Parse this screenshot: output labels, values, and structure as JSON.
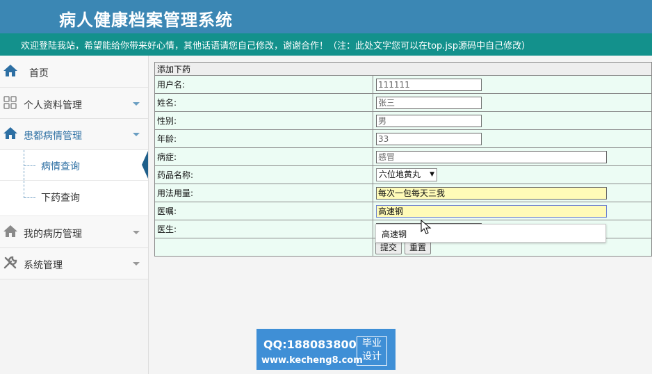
{
  "app": {
    "title": "病人健康档案管理系统",
    "notice": "欢迎登陆我站，希望能给你带来好心情，其他话语请您自己修改，谢谢合作！（注：此处文字您可以在top.jsp源码中自己修改）"
  },
  "sidebar": {
    "items": [
      {
        "label": "首页",
        "icon": "home-icon"
      },
      {
        "label": "个人资料管理",
        "icon": "grid-icon"
      },
      {
        "label": "患都病情管理",
        "icon": "home-icon"
      },
      {
        "label": "我的病历管理",
        "icon": "home-icon"
      },
      {
        "label": "系统管理",
        "icon": "wrench-icon"
      }
    ],
    "subitems": [
      {
        "label": "病情查询"
      },
      {
        "label": "下药查询"
      }
    ]
  },
  "form": {
    "caption": "添加下药",
    "fields": [
      {
        "label": "用户名:",
        "value": "111111"
      },
      {
        "label": "姓名:",
        "value": "张三"
      },
      {
        "label": "性别:",
        "value": "男"
      },
      {
        "label": "年龄:",
        "value": "33"
      },
      {
        "label": "病症:",
        "value": "感冒"
      },
      {
        "label": "药品名称:",
        "value": "六位地黄丸"
      },
      {
        "label": "用法用量:",
        "value": "每次一包每天三我"
      },
      {
        "label": "医嘱:",
        "value": "高速钢"
      },
      {
        "label": "医生:",
        "value": ""
      }
    ],
    "submit_label": "提交",
    "reset_label": "重置",
    "autocomplete": "高速钢"
  },
  "watermark": {
    "qq": "QQ:188083800",
    "url": "www.kecheng8.com",
    "tag_line1": "毕业",
    "tag_line2": "设计"
  },
  "colors": {
    "header": "#3b87b4",
    "notice_bar": "#13918c",
    "form_bg": "#ecfcf4",
    "highlight_input": "#fffbb8"
  }
}
